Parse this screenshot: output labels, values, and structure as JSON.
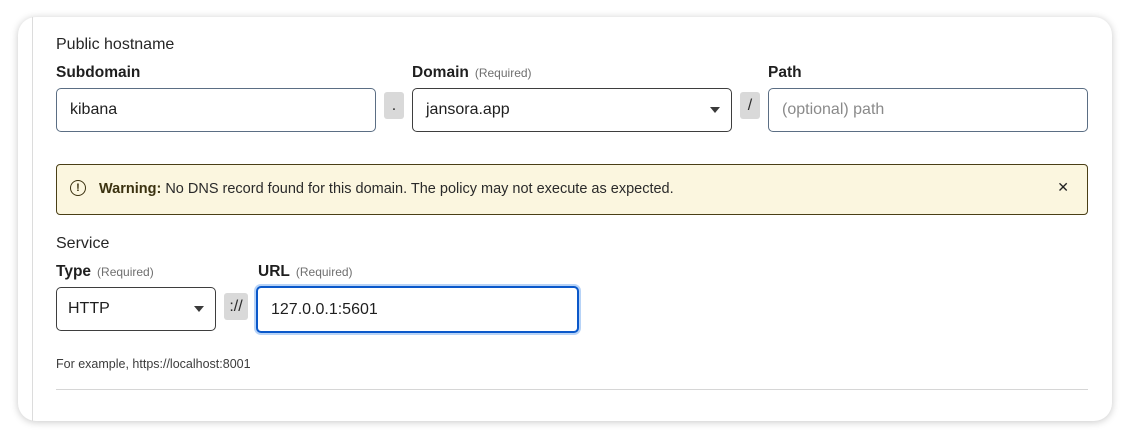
{
  "public_hostname": {
    "section_title": "Public hostname",
    "subdomain": {
      "label": "Subdomain",
      "value": "kibana"
    },
    "dot_separator": ".",
    "domain": {
      "label": "Domain",
      "required": "(Required)",
      "value": "jansora.app"
    },
    "slash_separator": "/",
    "path": {
      "label": "Path",
      "placeholder": "(optional) path"
    }
  },
  "warning": {
    "icon": "warning-circle-icon",
    "strong": "Warning:",
    "message": "No DNS record found for this domain. The policy may not execute as expected.",
    "close": "✕"
  },
  "service": {
    "section_title": "Service",
    "type": {
      "label": "Type",
      "required": "(Required)",
      "value": "HTTP"
    },
    "scheme_separator": "://",
    "url": {
      "label": "URL",
      "required": "(Required)",
      "value": "127.0.0.1:5601"
    },
    "hint": "For example, https://localhost:8001"
  },
  "colors": {
    "focus_border": "#0a58ca",
    "warning_bg": "#fbf6df",
    "warning_border": "#4a3f16"
  }
}
